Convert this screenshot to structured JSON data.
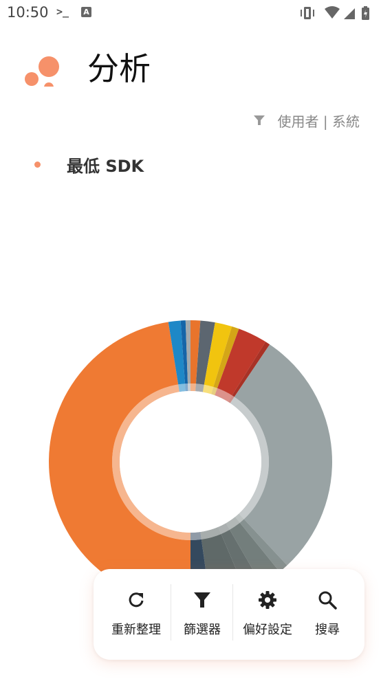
{
  "status_bar": {
    "time": "10:50",
    "terminal_glyph": ">_",
    "a_glyph": "A"
  },
  "header": {
    "title": "分析"
  },
  "filter_indicator": {
    "text": "使用者 | 系統"
  },
  "legend": {
    "label": "最低 SDK",
    "dot_color": "#f6916a"
  },
  "bottom_bar": {
    "refresh_label": "重新整理",
    "filter_label": "篩選器",
    "preferences_label": "偏好設定",
    "search_label": "搜尋"
  },
  "colors": {
    "accent": "#f6916a",
    "chart_orange": "#ef7a33",
    "chart_gray": "#99a3a4"
  }
}
